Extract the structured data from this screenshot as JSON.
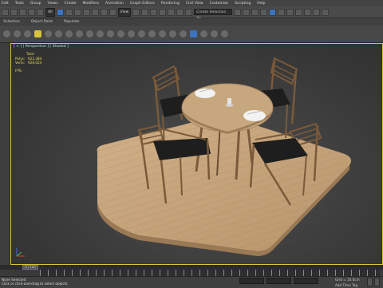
{
  "menu": {
    "items": [
      "Edit",
      "Tools",
      "Group",
      "Views",
      "Create",
      "Modifiers",
      "Animation",
      "Graph Editors",
      "Rendering",
      "Civil View",
      "Customize",
      "Scripting",
      "Help"
    ]
  },
  "toolbar": {
    "selection_filter": "All",
    "view_dropdown": "View",
    "named_selection_placeholder": "Create Selection Se"
  },
  "tabs": [
    "Selection",
    "Object Paint",
    "Populate"
  ],
  "viewport": {
    "label": "[ + ] [ Perspective ] [ Shaded ]",
    "stats": {
      "header": "Total",
      "rows": [
        {
          "label": "Polys:",
          "value": "922,384"
        },
        {
          "label": "Verts:",
          "value": "926,024"
        }
      ],
      "fps_label": "FPS:"
    }
  },
  "timeline": {
    "frame_readout": "0 / 100"
  },
  "status": {
    "line1": "None Selected",
    "line2": "Click or click-and-drag to select objects",
    "grid": "Grid = 10.0cm",
    "add_time_tag": "Add Time Tag"
  },
  "colors": {
    "viewport_border": "#e3c23a",
    "stats_text": "#e8d85a",
    "floor": "#c9a67a",
    "chair_wood": "#7a5a3a",
    "seat": "#1e1e1e",
    "table_top": "#c7a77e"
  }
}
